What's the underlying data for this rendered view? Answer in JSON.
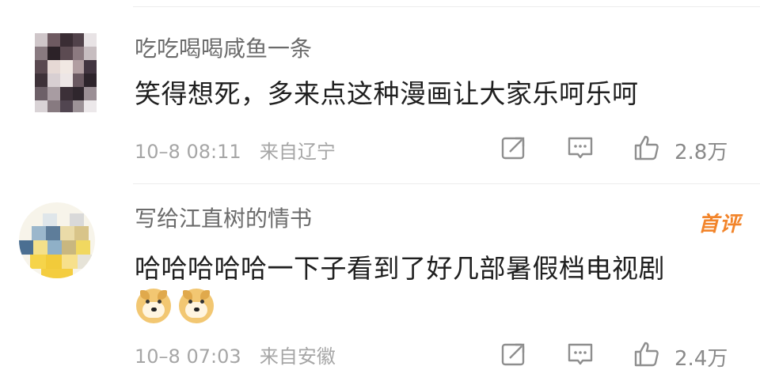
{
  "comments": [
    {
      "username": "吃吃喝喝咸鱼一条",
      "text": "笑得想死，多来点这种漫画让大家乐呵乐呵",
      "time": "10–8 08:11",
      "location": "来自辽宁",
      "likes": "2.8万",
      "emojis": []
    },
    {
      "username": "写给江直树的情书",
      "text": "哈哈哈哈哈一下子看到了好几部暑假档电视剧",
      "time": "10–8 07:03",
      "location": "来自安徽",
      "likes": "2.4万",
      "badge": "首评",
      "emojis": [
        "doge-emoji",
        "doge-emoji"
      ]
    }
  ],
  "icons": [
    "share-icon",
    "comment-icon",
    "like-icon"
  ],
  "colors": {
    "badge": "#f2842a",
    "meta": "#a6a6a6",
    "username": "#6b6b6b"
  }
}
